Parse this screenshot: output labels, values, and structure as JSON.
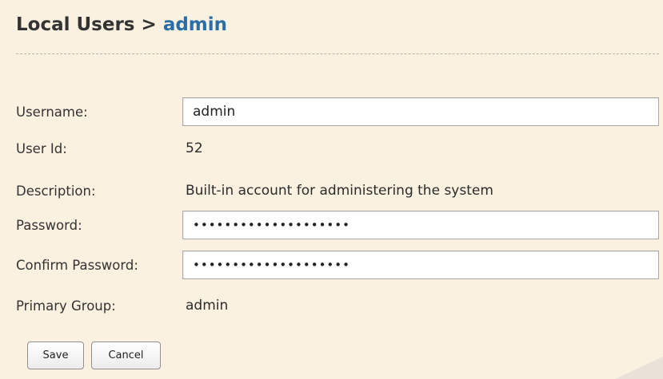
{
  "header": {
    "section": "Local Users",
    "separator": " > ",
    "current": "admin"
  },
  "form": {
    "username": {
      "label": "Username:",
      "value": "admin"
    },
    "user_id": {
      "label": "User Id:",
      "value": "52"
    },
    "description": {
      "label": "Description:",
      "value": "Built-in account for administering the system"
    },
    "password": {
      "label": "Password:",
      "value": "••••••••••••••••••••"
    },
    "confirm_password": {
      "label": "Confirm Password:",
      "value": "••••••••••••••••••••"
    },
    "primary_group": {
      "label": "Primary Group:",
      "value": "admin"
    }
  },
  "buttons": {
    "save": "Save",
    "cancel": "Cancel"
  },
  "colors": {
    "background": "#fbf1e1",
    "link_accent": "#2a6ea8"
  }
}
